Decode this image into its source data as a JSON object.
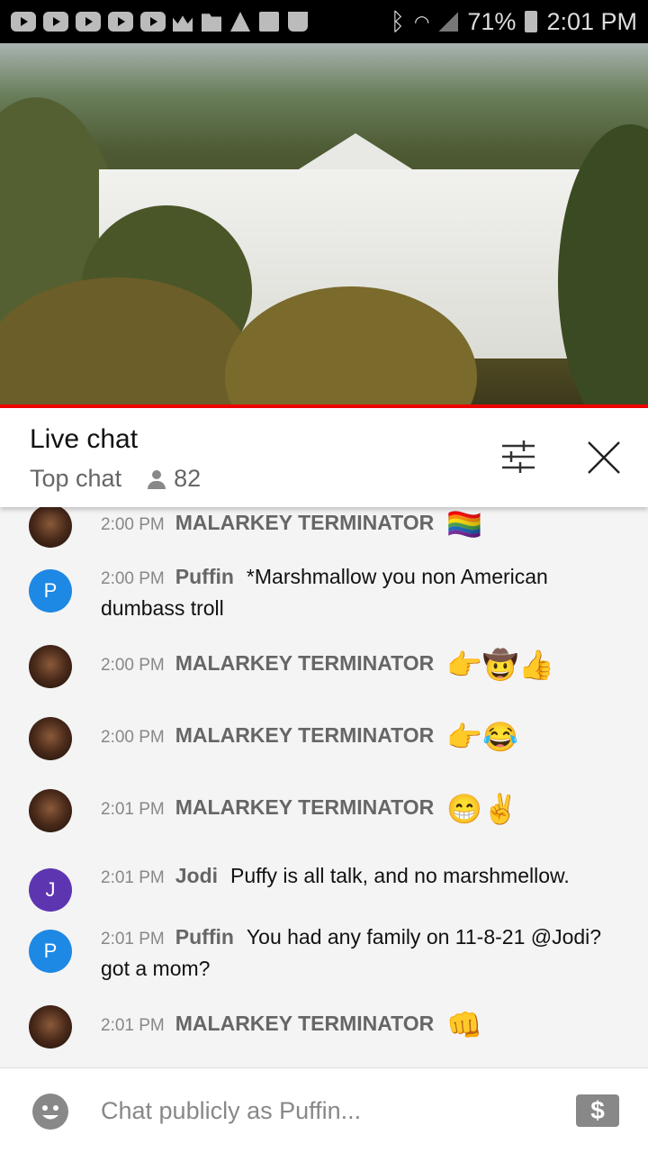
{
  "status_bar": {
    "battery": "71%",
    "time": "2:01 PM"
  },
  "chat_header": {
    "title": "Live chat",
    "mode": "Top chat",
    "viewer_count": "82"
  },
  "messages": [
    {
      "time": "2:00 PM",
      "author": "MALARKEY TERMINATOR",
      "text": "",
      "emoji": "🏳️‍🌈",
      "avatar": "image"
    },
    {
      "time": "2:00 PM",
      "author": "Puffin",
      "text": "*Marshmallow you non American dumbass troll",
      "emoji": "",
      "avatar": "P",
      "avatar_color": "#1e88e5"
    },
    {
      "time": "2:00 PM",
      "author": "MALARKEY TERMINATOR",
      "text": "",
      "emoji": "👉🤠👍",
      "avatar": "image"
    },
    {
      "time": "2:00 PM",
      "author": "MALARKEY TERMINATOR",
      "text": "",
      "emoji": "👉😂",
      "avatar": "image"
    },
    {
      "time": "2:01 PM",
      "author": "MALARKEY TERMINATOR",
      "text": "",
      "emoji": "😁✌️",
      "avatar": "image"
    },
    {
      "time": "2:01 PM",
      "author": "Jodi",
      "text": "Puffy is all talk, and no marshmellow.",
      "emoji": "",
      "avatar": "J",
      "avatar_color": "#5e35b1"
    },
    {
      "time": "2:01 PM",
      "author": "Puffin",
      "text": "You had any family on 11-8-21 @Jodi? got a mom?",
      "emoji": "",
      "avatar": "P",
      "avatar_color": "#1e88e5"
    },
    {
      "time": "2:01 PM",
      "author": "MALARKEY TERMINATOR",
      "text": "",
      "emoji": "👊",
      "avatar": "image"
    }
  ],
  "input": {
    "placeholder": "Chat publicly as Puffin..."
  },
  "icons": {
    "filter": "sliders-icon",
    "close": "close-icon",
    "emoji": "smiley-icon",
    "super_chat": "dollar-icon"
  }
}
